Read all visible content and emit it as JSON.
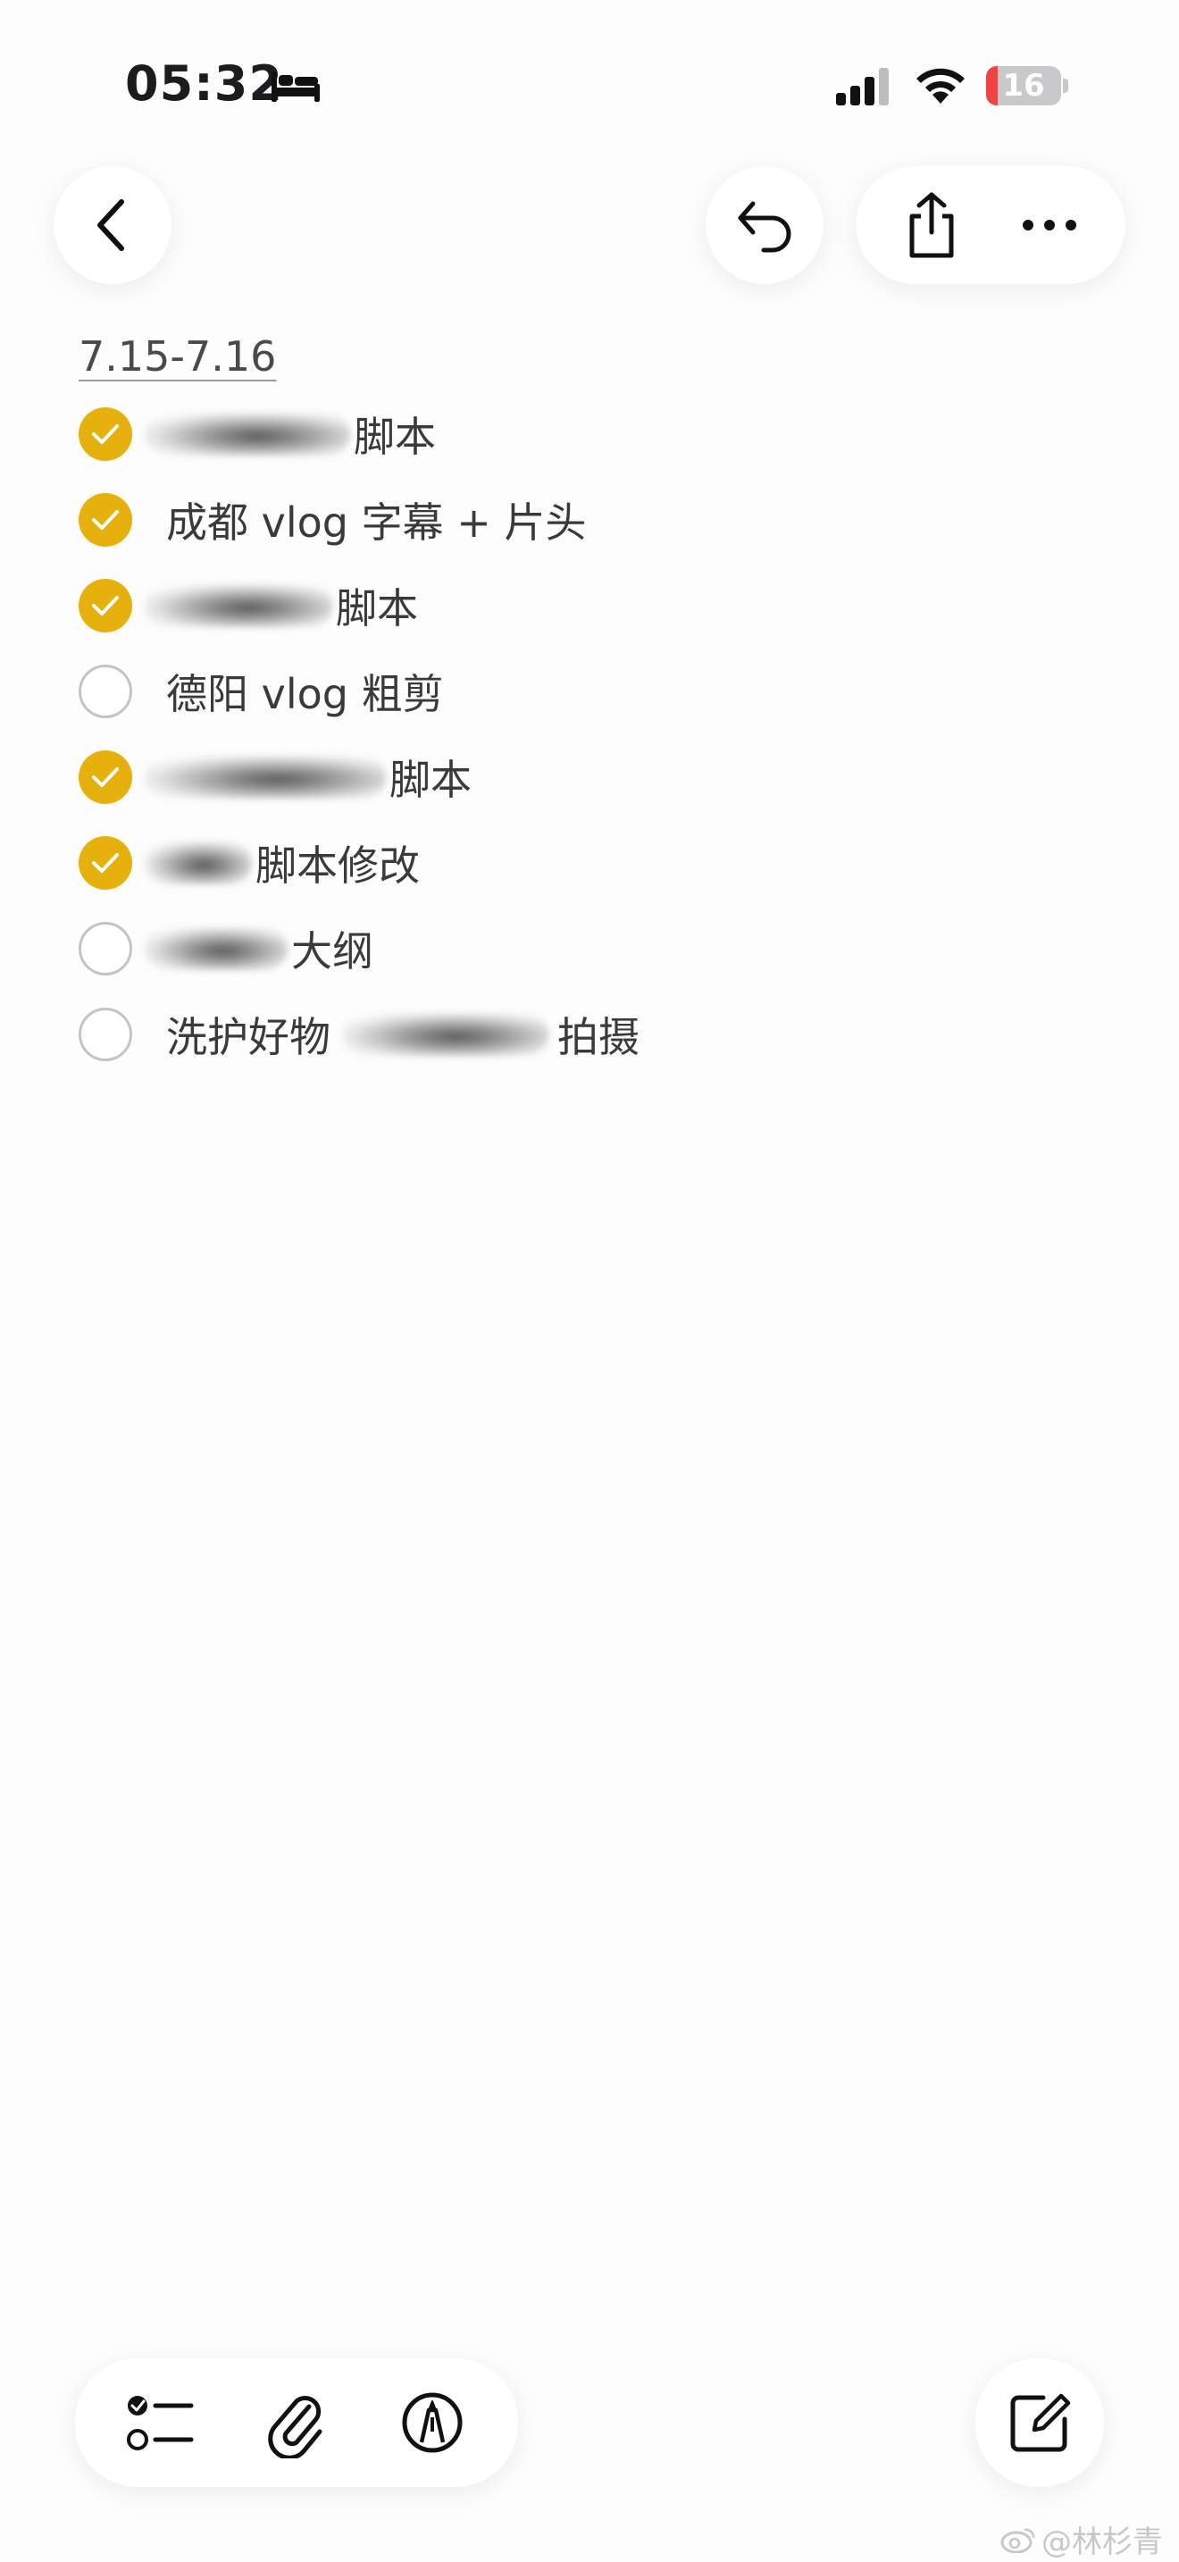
{
  "status_bar": {
    "time": "05:32",
    "battery_level": "16",
    "battery_fraction": 0.16
  },
  "note": {
    "date_heading": "7.15-7.16",
    "items": [
      {
        "checked": true,
        "redacted": true,
        "redact_width": 230,
        "text": "脚本"
      },
      {
        "checked": true,
        "redacted": false,
        "redact_width": 0,
        "text": "成都 vlog 字幕 + 片头"
      },
      {
        "checked": true,
        "redacted": true,
        "redact_width": 210,
        "text": "脚本"
      },
      {
        "checked": false,
        "redacted": false,
        "redact_width": 0,
        "text": "德阳 vlog 粗剪"
      },
      {
        "checked": true,
        "redacted": true,
        "redact_width": 270,
        "text": "脚本"
      },
      {
        "checked": true,
        "redacted": true,
        "redact_width": 120,
        "text": "脚本修改"
      },
      {
        "checked": false,
        "redacted": true,
        "redact_width": 160,
        "text": "大纲"
      },
      {
        "checked": false,
        "redacted": false,
        "redact_width": 0,
        "text": "洗护好物",
        "suffix_redact_width": 230,
        "suffix": "拍摄"
      }
    ]
  },
  "colors": {
    "accent": "#e6b10c",
    "battery_low": "#ef4444"
  },
  "icons": {
    "back": "chevron-left-icon",
    "undo": "undo-icon",
    "share": "share-icon",
    "more": "more-icon",
    "checklist": "checklist-icon",
    "attachment": "paperclip-icon",
    "markup": "pen-markup-icon",
    "compose": "compose-icon"
  },
  "watermark": "@林杉青"
}
